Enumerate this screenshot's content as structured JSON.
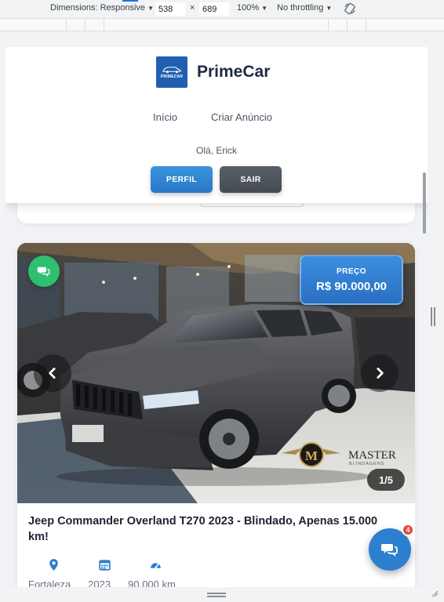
{
  "devtools": {
    "dimensions_label": "Dimensions: Responsive",
    "width_value": "538",
    "times": "×",
    "height_value": "689",
    "zoom": "100%",
    "throttling": "No throttling",
    "rotate_icon": "rotate-icon"
  },
  "header": {
    "logo_text": "PRIMECAR",
    "brand": "PrimeCar",
    "nav": [
      "Início",
      "Criar Anúncio"
    ],
    "greeting": "Olá, Erick",
    "profile_button": "PERFIL",
    "logout_button": "SAIR"
  },
  "listing": {
    "price_label": "PREÇO",
    "price_value": "R$ 90.000,00",
    "photo_counter": "1/5",
    "title": "Jeep Commander Overland T270 2023 - Blindado, Apenas 15.000 km!",
    "location": "Fortaleza",
    "year": "2023",
    "mileage": "90.000 km",
    "watermark": "MASTER",
    "watermark_sub": "BLINDAGENS",
    "watermark_letter": "M"
  },
  "chat": {
    "badge_count": "4"
  },
  "colors": {
    "primary": "#2d7fcf",
    "brand_text": "#1f2a44",
    "green_chat": "#2fbf71",
    "badge": "#e5483b",
    "logout": "#4a5057"
  }
}
